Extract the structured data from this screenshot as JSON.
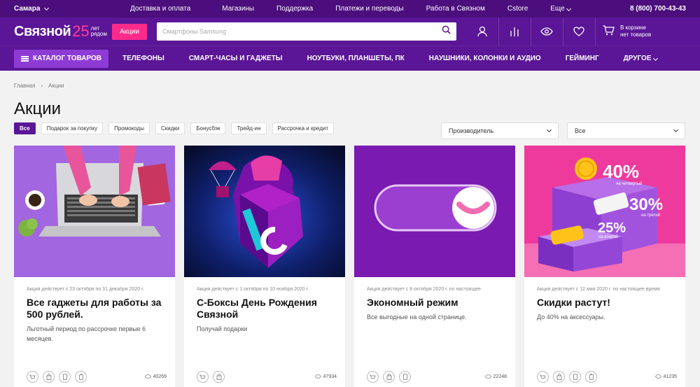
{
  "topbar": {
    "city": "Самара",
    "links": [
      "Доставка и оплата",
      "Магазины",
      "Поддержка",
      "Платежи и переводы",
      "Работа в Связном",
      "Cstore",
      "Еще"
    ],
    "phone": "8 (800) 700-43-43"
  },
  "header": {
    "logo_name": "Связной",
    "logo_number": "25",
    "logo_sub1": "лет",
    "logo_sub2": "рядом",
    "promo_button": "Акции",
    "search_placeholder": "Смартфоны Samsung",
    "cart_line1": "В корзине",
    "cart_line2": "нет товаров"
  },
  "nav": {
    "catalog": "КАТАЛОГ ТОВАРОВ",
    "items": [
      "ТЕЛЕФОНЫ",
      "СМАРТ-ЧАСЫ И ГАДЖЕТЫ",
      "НОУТБУКИ, ПЛАНШЕТЫ, ПК",
      "НАУШНИКИ, КОЛОНКИ И АУДИО",
      "ГЕЙМИНГ",
      "ДРУГОЕ"
    ]
  },
  "breadcrumb": {
    "home": "Главная",
    "current": "Акции"
  },
  "page_title": "Акции",
  "filters": [
    "Все",
    "Подарок за покупку",
    "Промокоды",
    "Скидки",
    "Бонусбэк",
    "Трейд-ин",
    "Рассрочка и кредит"
  ],
  "selects": {
    "manufacturer": "Производитель",
    "all": "Все"
  },
  "cards": [
    {
      "date": "Акция действует с 23 октября по 31 декабря 2020 г.",
      "title": "Все гаджеты для работы за 500 рублей.",
      "desc": "Льготный период по рассрочке первые 6 месяцев.",
      "views": "40269"
    },
    {
      "date": "Акция действует с 1 октября по 10 ноября 2020 г.",
      "title": "С-Боксы День Рождения Связной",
      "desc": "Получай подарки",
      "views": "47934"
    },
    {
      "date": "Акция действует с 8 октября 2020 г. по настоящее",
      "title": "Экономный режим",
      "desc": "Все выгодные на одной странице.",
      "views": "22248"
    },
    {
      "date": "Акция действует с 12 мая 2020 г. по настоящее время",
      "title": "Скидки растут!",
      "desc": "До 40% на аксессуары.",
      "views": "41235"
    }
  ],
  "promo_badges": {
    "p40": "40%",
    "p40_sub": "на четвертый",
    "p30": "30%",
    "p30_sub": "на третий",
    "p25": "25%",
    "p25_sub": "на второй"
  },
  "colors": {
    "brand": "#5a1696",
    "brand_dark": "#4b0e7c",
    "accent": "#ff2a8a",
    "catalog": "#8e3bd6"
  }
}
